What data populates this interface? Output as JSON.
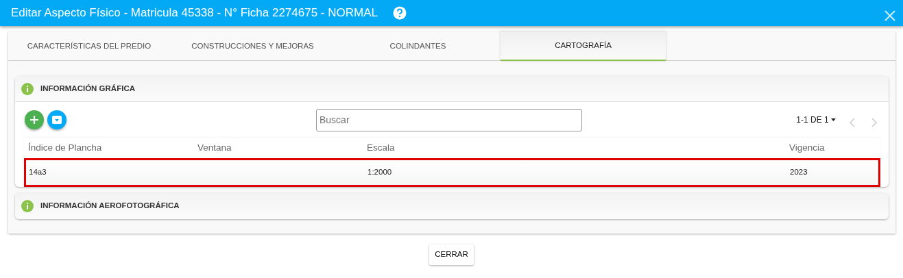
{
  "window": {
    "title": "Editar Aspecto Físico - Matricula 45338 - N° Ficha 2274675 - NORMAL"
  },
  "tabs": [
    {
      "label": "CARACTERÍSTICAS DEL PREDIO",
      "selected": false
    },
    {
      "label": "CONSTRUCCIONES Y MEJORAS",
      "selected": false
    },
    {
      "label": "COLINDANTES",
      "selected": false
    },
    {
      "label": "CARTOGRAFÍA",
      "selected": true
    }
  ],
  "sections": [
    {
      "title": "INFORMACIÓN GRÁFICA",
      "expanded": true,
      "search": {
        "placeholder": "Buscar"
      },
      "pagination": {
        "range": "1-1 DE 1",
        "prev_disabled": true,
        "next_disabled": true
      },
      "table": {
        "columns": [
          "Índice de Plancha",
          "Ventana",
          "Escala",
          "Vigencia"
        ],
        "rows": [
          {
            "cells": [
              "14a3",
              "",
              "1:2000",
              "2023"
            ],
            "highlighted": true
          }
        ]
      }
    },
    {
      "title": "INFORMACIÓN AEROFOTOGRÁFICA",
      "expanded": false
    }
  ],
  "buttons": [
    "CERRAR"
  ]
}
